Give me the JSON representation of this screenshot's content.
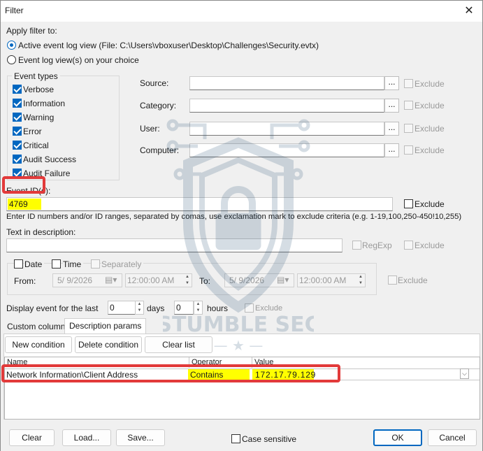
{
  "window": {
    "title": "Filter",
    "close_glyph": "✕"
  },
  "apply_filter": {
    "label": "Apply filter to:",
    "option_active": "Active event log view (File: C:\\Users\\vboxuser\\Desktop\\Challenges\\Security.evtx)",
    "option_choice": "Event log view(s) on your choice",
    "selected": "active"
  },
  "event_types": {
    "legend": "Event types",
    "items": [
      {
        "label": "Verbose",
        "checked": true
      },
      {
        "label": "Information",
        "checked": true
      },
      {
        "label": "Warning",
        "checked": true
      },
      {
        "label": "Error",
        "checked": true
      },
      {
        "label": "Critical",
        "checked": true
      },
      {
        "label": "Audit Success",
        "checked": true
      },
      {
        "label": "Audit Failure",
        "checked": true
      }
    ]
  },
  "fields": {
    "source_label": "Source:",
    "category_label": "Category:",
    "user_label": "User:",
    "computer_label": "Computer:",
    "browse_label": "...",
    "exclude_label": "Exclude"
  },
  "event_id": {
    "label": "Event ID(s):",
    "value": "4769",
    "exclude_label": "Exclude",
    "hint": "Enter ID numbers and/or ID ranges, separated by comas, use exclamation mark to exclude criteria (e.g. 1-19,100,250-450!10,255)"
  },
  "text_desc": {
    "label": "Text in description:",
    "regexp_label": "RegExp",
    "exclude_label": "Exclude"
  },
  "datetime": {
    "date_label": "Date",
    "time_label": "Time",
    "separately_label": "Separately",
    "from_label": "From:",
    "to_label": "To:",
    "from_date": "5/  9/2026",
    "from_time": "12:00:00 AM",
    "to_date": "5/  9/2026",
    "to_time": "12:00:00 AM",
    "exclude_label": "Exclude"
  },
  "display_last": {
    "label": "Display event for the last",
    "days_value": "0",
    "days_label": "days",
    "hours_value": "0",
    "hours_label": "hours",
    "exclude_label": "Exclude"
  },
  "tabs": [
    {
      "label": "Custom columns"
    },
    {
      "label": "Description params"
    }
  ],
  "params_toolbar": {
    "new_label": "New condition",
    "delete_label": "Delete condition",
    "clear_label": "Clear list"
  },
  "params_table": {
    "columns": [
      "Name",
      "Operator",
      "Value"
    ],
    "rows": [
      {
        "name": "Network Information\\Client Address",
        "operator": "Contains",
        "value": "172.17.79.129"
      }
    ]
  },
  "footer": {
    "clear_label": "Clear",
    "load_label": "Load...",
    "save_label": "Save...",
    "case_label": "Case sensitive",
    "ok_label": "OK",
    "cancel_label": "Cancel"
  },
  "watermark": {
    "text": "STUMBLE SEC",
    "icon": "shield-lock-icon"
  },
  "colors": {
    "accent": "#0067c0",
    "highlight": "#ffff00",
    "annotation": "#e23a3a"
  }
}
